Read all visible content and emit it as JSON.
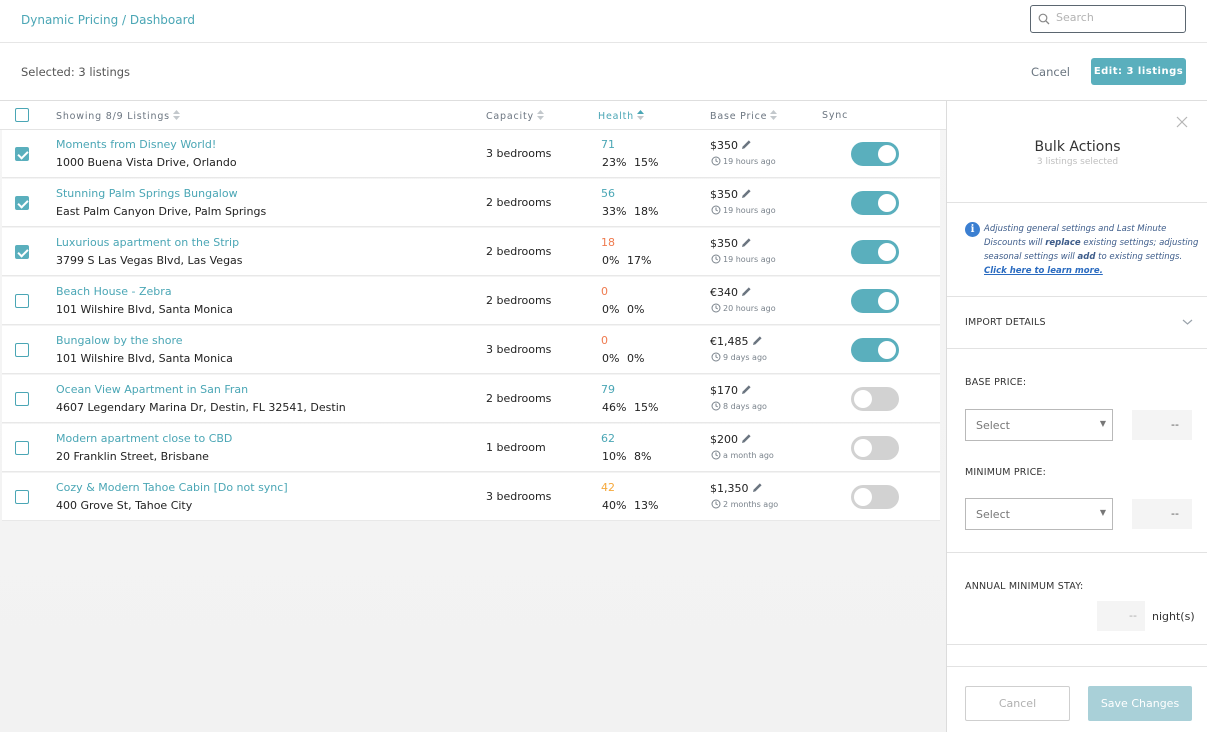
{
  "header": {
    "breadcrumb": "Dynamic Pricing / Dashboard",
    "search_placeholder": "Search"
  },
  "selection_bar": {
    "selected_text": "Selected: 3 listings",
    "cancel_label": "Cancel",
    "edit_label": "Edit: 3 listings"
  },
  "table": {
    "columns": {
      "listing": "Showing 8/9 Listings",
      "capacity": "Capacity",
      "health": "Health",
      "base_price": "Base Price",
      "sync": "Sync"
    },
    "rows": [
      {
        "name": "Moments from Disney World!",
        "address": "1000 Buena Vista Drive, Orlando",
        "capacity": "3 bedrooms",
        "health": "71",
        "health_color": "#4aa6b5",
        "pcts": "23% 15%",
        "price": "$350",
        "updated": "19 hours ago",
        "checked": true,
        "sync": true
      },
      {
        "name": "Stunning Palm Springs Bungalow",
        "address": "East Palm Canyon Drive, Palm Springs",
        "capacity": "2 bedrooms",
        "health": "56",
        "health_color": "#4aa6b5",
        "pcts": "33% 18%",
        "price": "$350",
        "updated": "19 hours ago",
        "checked": true,
        "sync": true
      },
      {
        "name": "Luxurious apartment on the Strip",
        "address": "3799 S Las Vegas Blvd, Las Vegas",
        "capacity": "2 bedrooms",
        "health": "18",
        "health_color": "#ef7b4f",
        "pcts": "0% 17%",
        "price": "$350",
        "updated": "19 hours ago",
        "checked": true,
        "sync": true
      },
      {
        "name": "Beach House - Zebra",
        "address": "101 Wilshire Blvd, Santa Monica",
        "capacity": "2 bedrooms",
        "health": "0",
        "health_color": "#ef7b4f",
        "pcts": "0% 0%",
        "price": "€340",
        "updated": "20 hours ago",
        "checked": false,
        "sync": true
      },
      {
        "name": "Bungalow by the shore",
        "address": "101 Wilshire Blvd, Santa Monica",
        "capacity": "3 bedrooms",
        "health": "0",
        "health_color": "#ef7b4f",
        "pcts": "0% 0%",
        "price": "€1,485",
        "updated": "9 days ago",
        "checked": false,
        "sync": true
      },
      {
        "name": "Ocean View Apartment in San Fran",
        "address": "4607 Legendary Marina Dr, Destin, FL 32541, Destin",
        "capacity": "2 bedrooms",
        "health": "79",
        "health_color": "#4aa6b5",
        "pcts": "46% 15%",
        "price": "$170",
        "updated": "8 days ago",
        "checked": false,
        "sync": false
      },
      {
        "name": "Modern apartment close to CBD",
        "address": "20 Franklin Street, Brisbane",
        "capacity": "1 bedroom",
        "health": "62",
        "health_color": "#4aa6b5",
        "pcts": "10% 8%",
        "price": "$200",
        "updated": "a month ago",
        "checked": false,
        "sync": false
      },
      {
        "name": "Cozy & Modern Tahoe Cabin [Do not sync]",
        "address": "400 Grove St, Tahoe City",
        "capacity": "3 bedrooms",
        "health": "42",
        "health_color": "#f5a83b",
        "pcts": "40% 13%",
        "price": "$1,350",
        "updated": "2 months ago",
        "checked": false,
        "sync": false
      }
    ]
  },
  "panel": {
    "title": "Bulk Actions",
    "subtitle": "3 listings selected",
    "info_pre": "Adjusting general settings and Last Minute Discounts will ",
    "info_replace": "replace",
    "info_mid": " existing settings; adjusting seasonal settings will ",
    "info_add": "add",
    "info_post": " to existing settings. ",
    "info_link": "Click here to learn more.",
    "import_label": "IMPORT DETAILS",
    "base_price_label": "BASE PRICE:",
    "base_price_select": "Select",
    "base_price_value": "--",
    "min_price_label": "MINIMUM PRICE:",
    "min_price_select": "Select",
    "min_price_value": "--",
    "annual_min_stay_label": "ANNUAL MINIMUM STAY:",
    "annual_min_stay_value": "--",
    "nights_label": "night(s)",
    "cancel_label": "Cancel",
    "save_label": "Save Changes"
  }
}
